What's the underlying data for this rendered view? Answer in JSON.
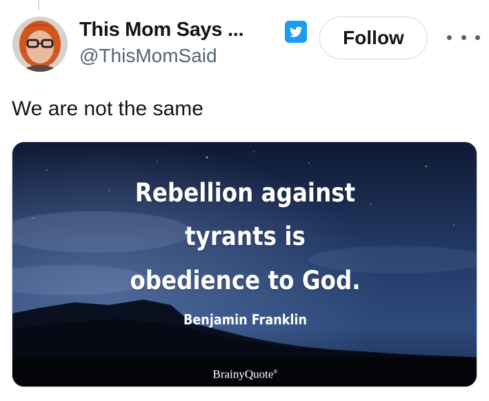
{
  "user": {
    "display_name": "This Mom Says ...",
    "handle": "@ThisMomSaid",
    "avatar_icon": "avatar-icon"
  },
  "header": {
    "badge_icon": "twitter-bird-icon",
    "follow_label": "Follow",
    "more_icon": "more-options-icon"
  },
  "tweet": {
    "text": "We are not the same"
  },
  "media": {
    "quote_lines": [
      "Rebellion against",
      "tyrants is",
      "obedience to God."
    ],
    "author": "Benjamin Franklin",
    "brand": "BrainyQuote"
  },
  "colors": {
    "accent": "#1d9bf0",
    "text_primary": "#0f1419",
    "text_secondary": "#536471",
    "border": "#cfd9de"
  }
}
